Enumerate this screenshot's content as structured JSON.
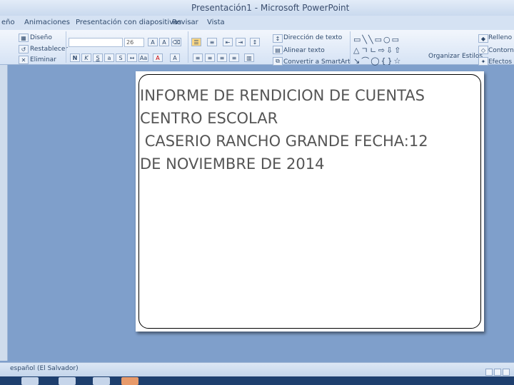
{
  "window": {
    "title": "Presentación1 - Microsoft PowerPoint"
  },
  "ribbon_tabs": [
    {
      "label": "eño"
    },
    {
      "label": "Animaciones"
    },
    {
      "label": "Presentación con diapositivas"
    },
    {
      "label": "Revisar"
    },
    {
      "label": "Vista"
    }
  ],
  "ribbon": {
    "slides_group": {
      "design": "Diseño",
      "reset": "Restablecer",
      "delete": "Eliminar"
    },
    "font_size": "26",
    "text_group": {
      "direction": "Dirección de texto",
      "align": "Alinear texto",
      "smartart": "Convertir a SmartArt"
    },
    "drawing_group": {
      "arrange": "Organizar",
      "styles": "Estilos"
    },
    "right_group": {
      "fill": "Relleno",
      "outline": "Contorno",
      "effects": "Efectos"
    }
  },
  "slide": {
    "text": "INFORME DE RENDICION DE CUENTAS\nCENTRO ESCOLAR\n CASERIO RANCHO GRANDE FECHA:12\nDE NOVIEMBRE DE 2014"
  },
  "status": {
    "language": "español (El Salvador)"
  }
}
